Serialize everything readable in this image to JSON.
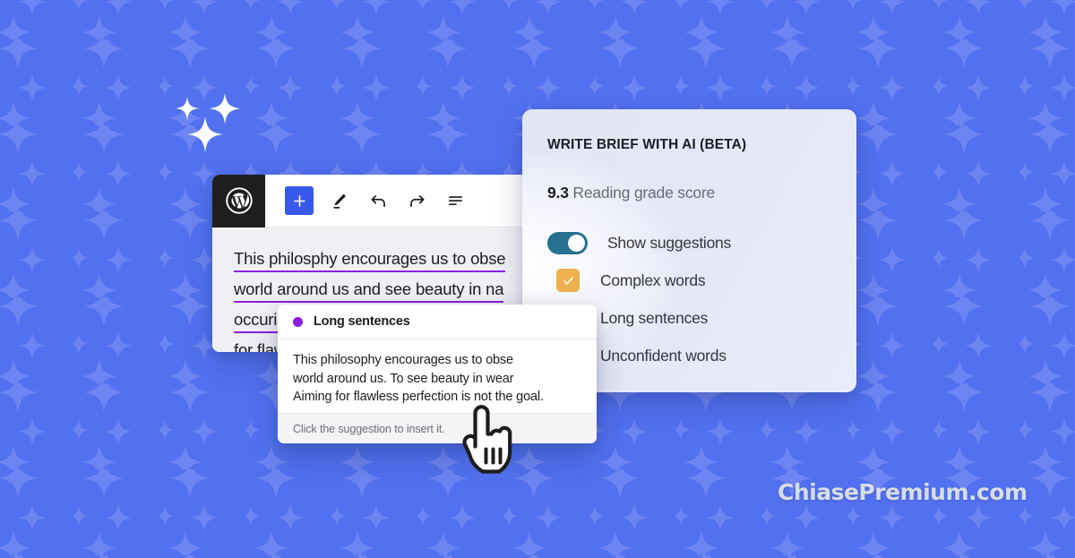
{
  "background": {
    "color": "#5271f0",
    "sparkle_color": "#6e86f3",
    "pattern_name": "sparkle-tile"
  },
  "hero_sparkles": {
    "name": "ai-sparkles-decoration",
    "color": "#ffffff",
    "count": 3
  },
  "editor": {
    "logo": "wordpress-logo",
    "toolbar": [
      {
        "name": "add-block-button",
        "icon": "plus-icon",
        "label": "+",
        "active": true
      },
      {
        "name": "edit-tool-button",
        "icon": "pencil-icon",
        "label": ""
      },
      {
        "name": "undo-button",
        "icon": "undo-arrow-icon",
        "label": ""
      },
      {
        "name": "redo-button",
        "icon": "redo-arrow-icon",
        "label": ""
      },
      {
        "name": "details-button",
        "icon": "document-outline-icon",
        "label": ""
      }
    ],
    "paragraph_lines": [
      "This philosphy encourages us to obse",
      "world around us and see beauty in na",
      "occuring wear and tear rather than ai",
      "for flawless perfection."
    ],
    "underline_color": "#8a1fe0"
  },
  "suggestion_popup": {
    "dot_color": "#8a1fe0",
    "title": "Long sentences",
    "body_lines": [
      "This philosophy encourages us to obse",
      "world around us. To see beauty in wear",
      "Aiming for flawless perfection is not the goal."
    ],
    "footer": "Click the suggestion to insert it."
  },
  "ai_panel": {
    "heading": "WRITE BRIEF WITH AI (BETA)",
    "reading_score": {
      "value": "9.3",
      "label": "Reading grade score"
    },
    "options": [
      {
        "name": "show-suggestions-toggle",
        "label": "Show suggestions",
        "control": "toggle",
        "state": "on",
        "color": "#25718f"
      },
      {
        "name": "complex-words-checkbox",
        "label": "Complex words",
        "control": "checkbox",
        "state": "checked",
        "color": "#efb04e"
      },
      {
        "name": "long-sentences-checkbox",
        "label": "Long sentences",
        "control": "checkbox",
        "state": "checked",
        "color": "#8a1fe0"
      },
      {
        "name": "unconfident-words-checkbox",
        "label": "Unconfident words",
        "control": "checkbox",
        "state": "checked",
        "color": "#1cbc8c"
      }
    ]
  },
  "cursor": {
    "name": "pointing-hand-cursor",
    "fill": "#ffffff",
    "stroke": "#1d1d1f"
  },
  "watermark": {
    "text": "ChiasePremium.com",
    "color": "#d9dde4"
  }
}
